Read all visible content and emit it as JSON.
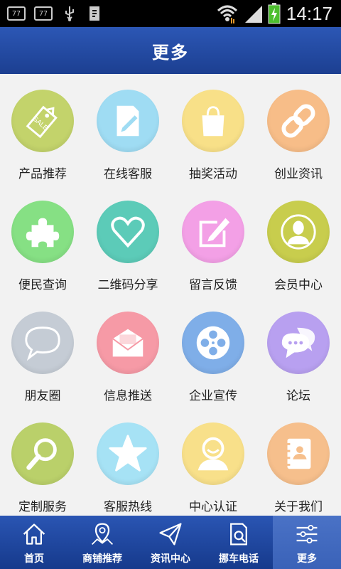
{
  "statusbar": {
    "time": "14:17",
    "notif1": "77",
    "notif2": "77"
  },
  "header": {
    "title": "更多"
  },
  "grid": [
    {
      "label": "产品推荐",
      "color": "#c3d36b",
      "icon": "sale-tag-icon"
    },
    {
      "label": "在线客服",
      "color": "#9fdcf3",
      "icon": "document-pen-icon"
    },
    {
      "label": "抽奖活动",
      "color": "#f8e088",
      "icon": "shopping-bag-icon"
    },
    {
      "label": "创业资讯",
      "color": "#f7bd88",
      "icon": "chain-link-icon"
    },
    {
      "label": "便民查询",
      "color": "#86e084",
      "icon": "puzzle-icon"
    },
    {
      "label": "二维码分享",
      "color": "#5ccbb8",
      "icon": "heart-icon"
    },
    {
      "label": "留言反馈",
      "color": "#f3a0e6",
      "icon": "note-edit-icon"
    },
    {
      "label": "会员中心",
      "color": "#c8cd4d",
      "icon": "person-silhouette-icon"
    },
    {
      "label": "朋友圈",
      "color": "#c5ccd5",
      "icon": "speech-bubble-icon"
    },
    {
      "label": "信息推送",
      "color": "#f69aa6",
      "icon": "envelope-icon"
    },
    {
      "label": "企业宣传",
      "color": "#7faee8",
      "icon": "film-reel-icon"
    },
    {
      "label": "论坛",
      "color": "#b8a0f0",
      "icon": "chat-bubbles-icon"
    },
    {
      "label": "定制服务",
      "color": "#bad06a",
      "icon": "magnifier-icon"
    },
    {
      "label": "客服热线",
      "color": "#a6e2f5",
      "icon": "star-icon"
    },
    {
      "label": "中心认证",
      "color": "#f8e08a",
      "icon": "smiley-person-icon"
    },
    {
      "label": "关于我们",
      "color": "#f6bf8c",
      "icon": "contact-book-icon"
    }
  ],
  "bottomnav": [
    {
      "label": "首页",
      "icon": "home-icon"
    },
    {
      "label": "商铺推荐",
      "icon": "map-pin-icon"
    },
    {
      "label": "资讯中心",
      "icon": "paper-plane-icon"
    },
    {
      "label": "挪车电话",
      "icon": "document-search-icon"
    },
    {
      "label": "更多",
      "icon": "sliders-icon"
    }
  ]
}
